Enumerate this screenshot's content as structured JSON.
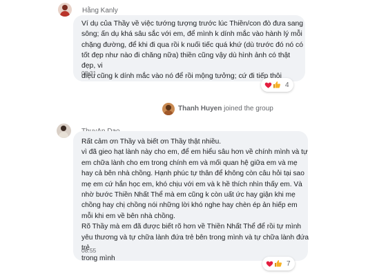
{
  "messages": [
    {
      "sender": "Hằng Kanly",
      "text": "Ví dụ của Thầy về việc tướng tượng trước lúc Thiền/con đò đưa sang\nsông; ấn dụ khá sâu sắc với em, để mình k dính mắc vào hành lý mỗi\nchặng đường, để khi đi qua rồi k nuối tiếc quá khứ (dù trước đó nó có\ntốt đẹp như nào đi chăng nữa) thiền cũng vậy dù hình ảnh có thật đẹp, vi\ndiệu cũng k dính mắc vào nó để rồi mộng tưởng; cứ đi tiếp thôi",
      "time": "08:31",
      "reaction_count": "4",
      "avatar_colors": {
        "bg": "#e8d2c8",
        "head": "#7a2b20",
        "body": "#b8342a"
      }
    },
    {
      "sender": "ThuyAn Dao",
      "text": "Rất cảm ơn Thầy và biết ơn Thầy thật nhiều.\nvì đã gieo hạt lành này cho em, để em hiểu sâu hơn về chính mình và tự\nem chữa lành cho em trong chính em và mối quan hệ giữa em và mẹ\nhay cả bên nhà chồng. Hạnh phúc tự thân để không còn câu hỏi tại sao\nmẹ em cứ hắn học em, khó chịu với em và k hề thích nhìn thấy em. Và\nnhờ bước Thiền  Nhất Thể mà em cũng k còn uất ức hay giận khi mẹ\nchồng hay chị chồng nói những lời khó nghe hay chèn ép ản hiếp em\nmỗi khi em về bên nhà chồng.\nRõ Thầy mà em đã được biết rõ hơn về Thiền Nhất Thể để rồi tự mình\nyêu thương và tự chữa lành đứa trẻ bên trong mình và tự chữa lành đứa trẻ\ntrong mình",
      "time": "08:55",
      "reaction_count": "7",
      "avatar_colors": {
        "bg": "#d9cfc6",
        "head": "#3a2a22",
        "body": "#e7e0d6"
      }
    }
  ],
  "system_event": {
    "name": "Thanh Huyen",
    "action": "joined the group",
    "avatar_colors": {
      "bg": "#c98a52",
      "head": "#5a3318",
      "body": "#a0582a"
    }
  },
  "colors": {
    "heart": "#e41e3f",
    "like": "#f7b125"
  },
  "icons": [
    "heart-reaction-icon",
    "thumbs-up-reaction-icon"
  ]
}
